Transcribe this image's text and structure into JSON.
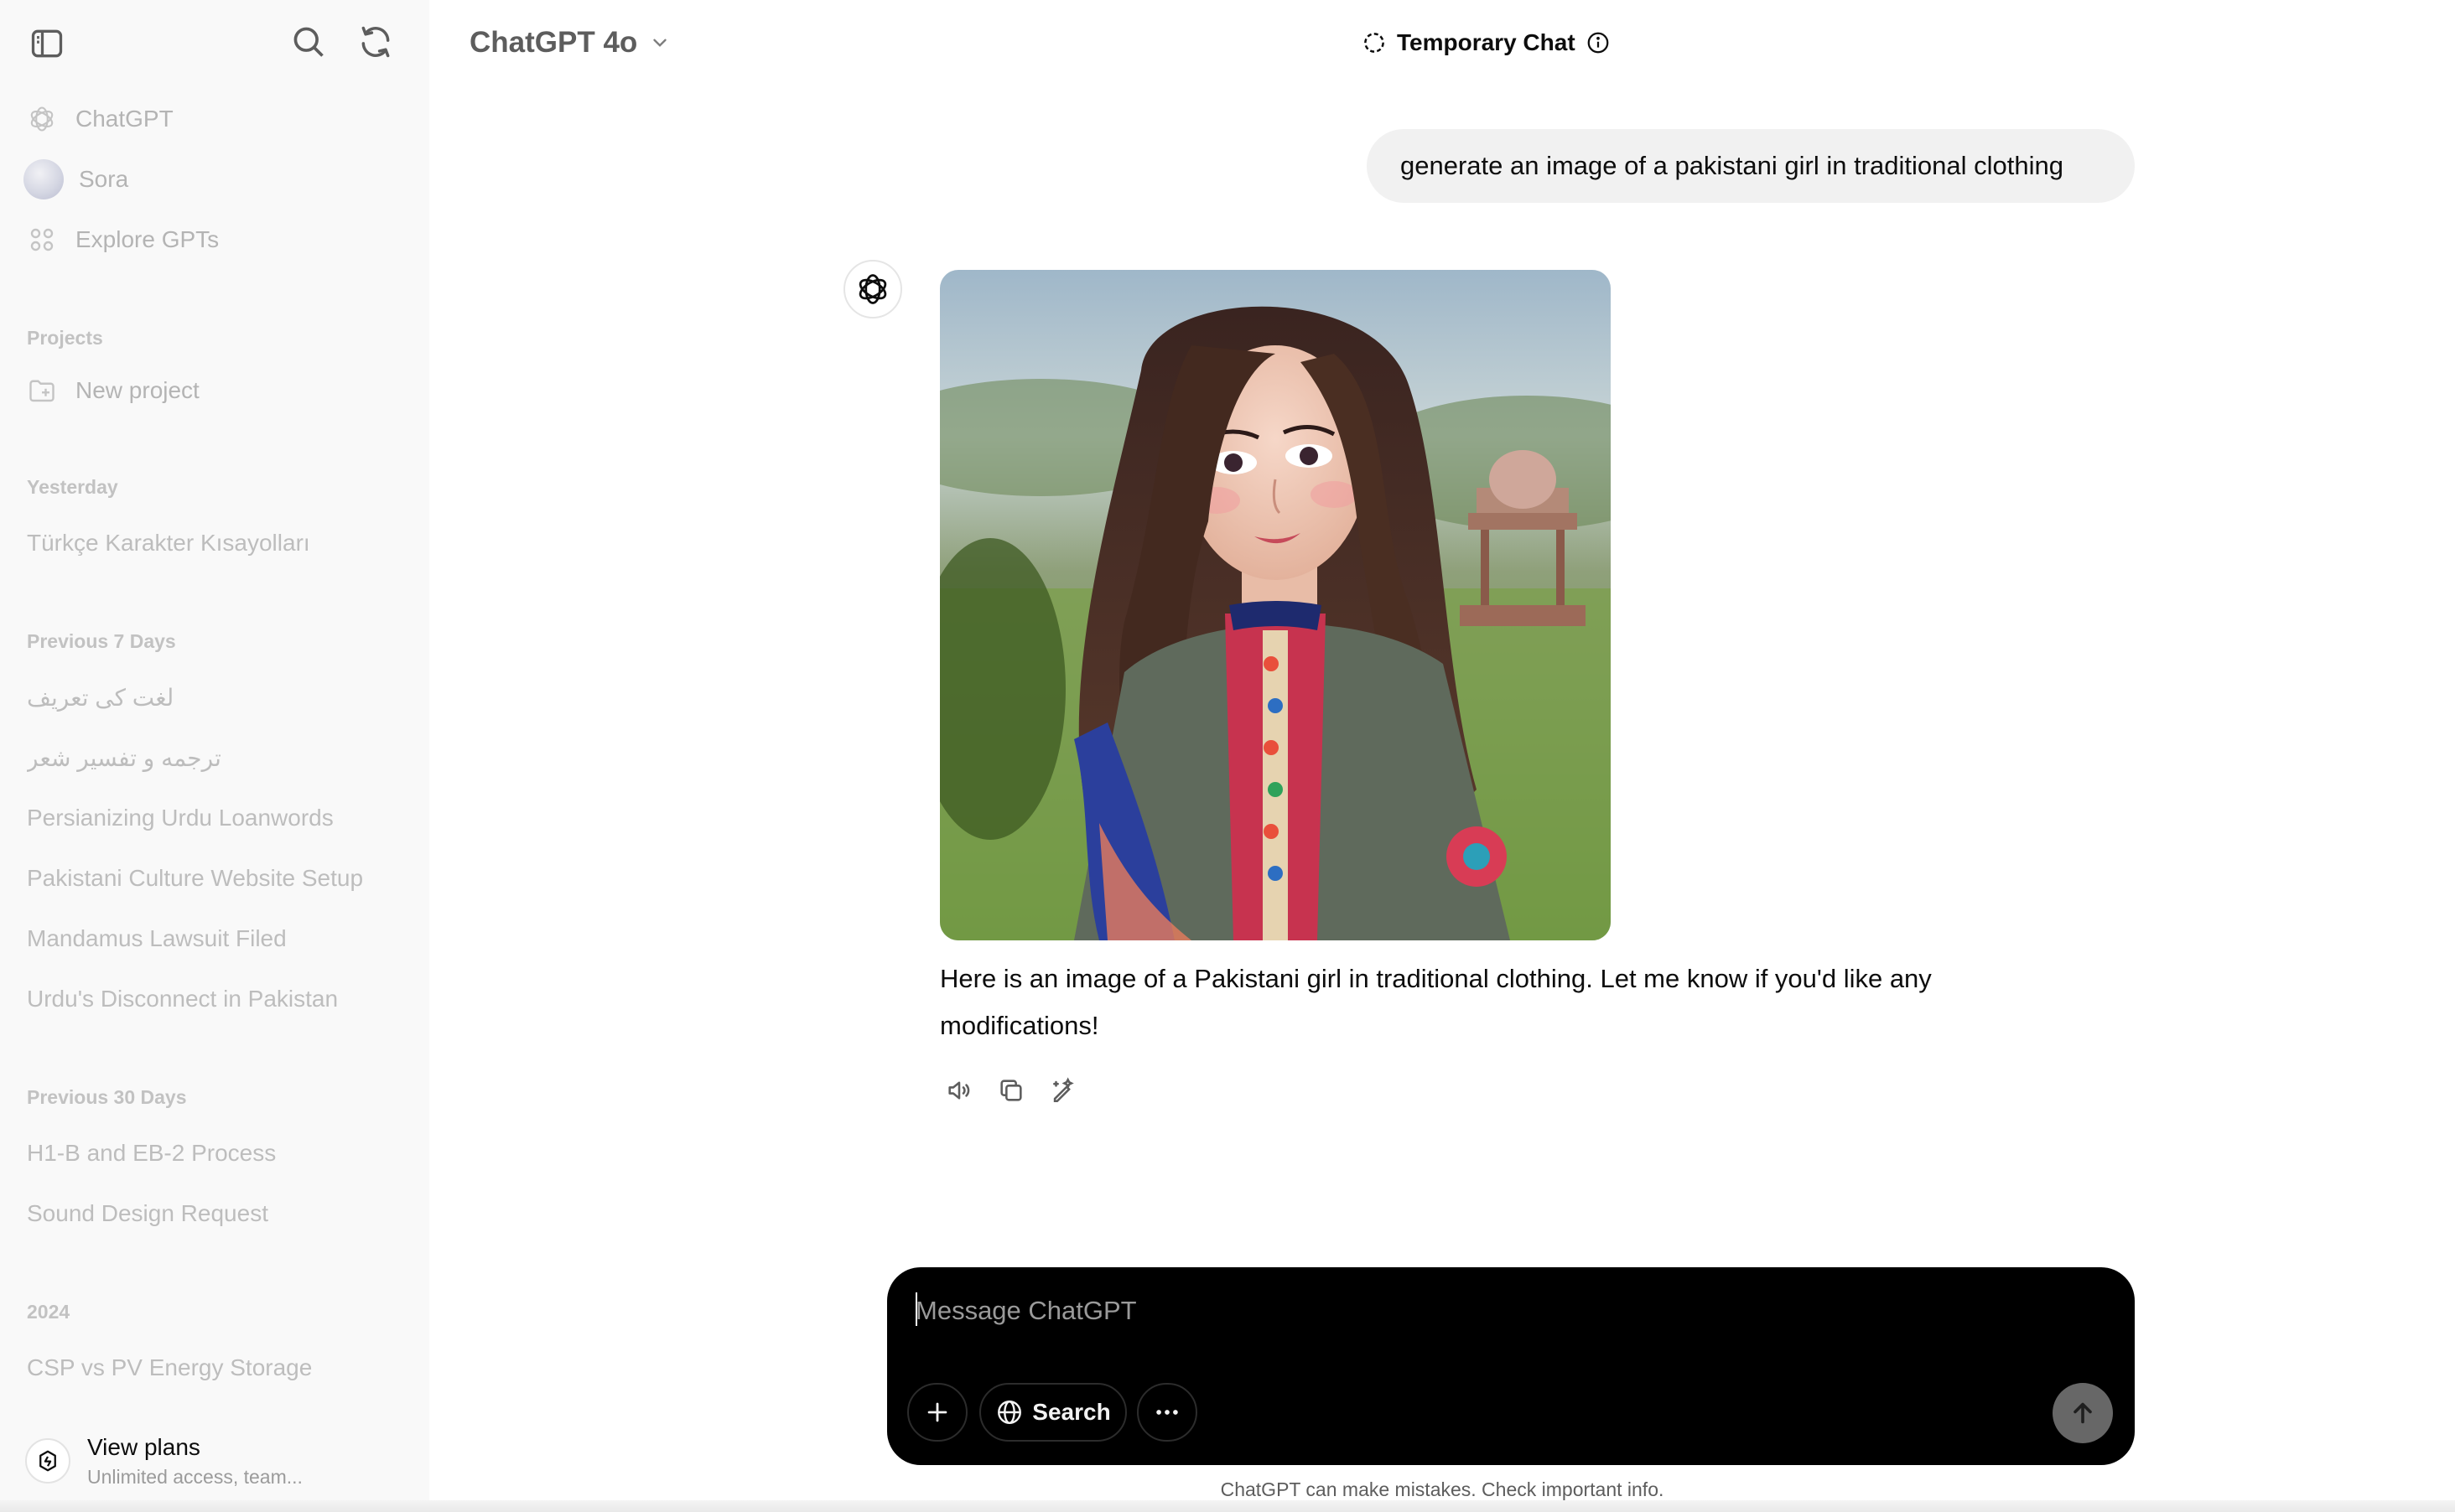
{
  "sidebar": {
    "nav": [
      {
        "label": "ChatGPT",
        "icon": "chatgpt-logo-icon"
      },
      {
        "label": "Sora",
        "icon": "sora-avatar"
      },
      {
        "label": "Explore GPTs",
        "icon": "grid-icon"
      }
    ],
    "projects_label": "Projects",
    "new_project": "New project",
    "sections": {
      "yesterday": "Yesterday",
      "prev7": "Previous 7 Days",
      "prev30": "Previous 30 Days",
      "y2024": "2024"
    },
    "history": {
      "yesterday": [
        "Türkçe Karakter Kısayolları"
      ],
      "prev7": [
        "لغت کی تعریف",
        "ترجمه و تفسیر شعر",
        "Persianizing Urdu Loanwords",
        "Pakistani Culture Website Setup",
        "Mandamus Lawsuit Filed",
        "Urdu's Disconnect in Pakistan"
      ],
      "prev30": [
        "H1-B and EB-2 Process",
        "Sound Design Request"
      ],
      "y2024": [
        "CSP vs PV Energy Storage"
      ]
    },
    "view_plans": {
      "title": "View plans",
      "subtitle": "Unlimited access, team..."
    }
  },
  "header": {
    "model": "ChatGPT 4o",
    "temporary_chat": "Temporary Chat"
  },
  "conversation": {
    "user_message": "generate an image of a pakistani girl in traditional clothing",
    "assistant_reply": "Here is an image of a Pakistani girl in traditional clothing. Let me know if you'd like any modifications!"
  },
  "composer": {
    "placeholder": "Message ChatGPT",
    "search_label": "Search"
  },
  "disclaimer": "ChatGPT can make mistakes. Check important info.",
  "colors": {
    "sidebar_bg": "#f9f9f9",
    "composer_bg": "#000000",
    "bubble_bg": "#f1f1f1",
    "send_btn": "#676767"
  }
}
